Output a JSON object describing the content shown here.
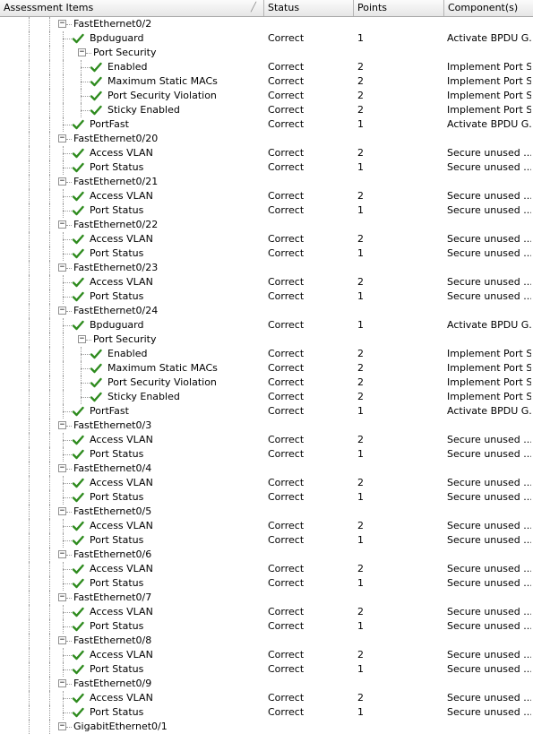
{
  "header": {
    "columns": [
      {
        "label": "Assessment Items"
      },
      {
        "label": "Status"
      },
      {
        "label": "Points"
      },
      {
        "label": "Component(s)"
      }
    ]
  },
  "colors": {
    "check": "#2e8b1e",
    "guide": "#9a9a9a",
    "header_bg": "#ececec"
  },
  "icons": {
    "expanded": "minus-box-icon",
    "check": "check-mark-icon"
  },
  "rows": [
    {
      "level": 0,
      "kind": "group",
      "label": "FastEthernet0/2"
    },
    {
      "level": 1,
      "kind": "item",
      "label": "Bpduguard",
      "status": "Correct",
      "points": "1",
      "component": "Activate BPDU G..."
    },
    {
      "level": 1,
      "kind": "group",
      "label": "Port Security"
    },
    {
      "level": 2,
      "kind": "item",
      "label": "Enabled",
      "status": "Correct",
      "points": "2",
      "component": "Implement Port S..."
    },
    {
      "level": 2,
      "kind": "item",
      "label": "Maximum Static MACs",
      "status": "Correct",
      "points": "2",
      "component": "Implement Port S..."
    },
    {
      "level": 2,
      "kind": "item",
      "label": "Port Security Violation",
      "status": "Correct",
      "points": "2",
      "component": "Implement Port S..."
    },
    {
      "level": 2,
      "kind": "item",
      "label": "Sticky Enabled",
      "status": "Correct",
      "points": "2",
      "component": "Implement Port S..."
    },
    {
      "level": 1,
      "kind": "item",
      "label": "PortFast",
      "status": "Correct",
      "points": "1",
      "component": "Activate BPDU G..."
    },
    {
      "level": 0,
      "kind": "group",
      "label": "FastEthernet0/20"
    },
    {
      "level": 1,
      "kind": "item",
      "label": "Access VLAN",
      "status": "Correct",
      "points": "2",
      "component": "Secure unused ..."
    },
    {
      "level": 1,
      "kind": "item",
      "label": "Port Status",
      "status": "Correct",
      "points": "1",
      "component": "Secure unused ..."
    },
    {
      "level": 0,
      "kind": "group",
      "label": "FastEthernet0/21"
    },
    {
      "level": 1,
      "kind": "item",
      "label": "Access VLAN",
      "status": "Correct",
      "points": "2",
      "component": "Secure unused ..."
    },
    {
      "level": 1,
      "kind": "item",
      "label": "Port Status",
      "status": "Correct",
      "points": "1",
      "component": "Secure unused ..."
    },
    {
      "level": 0,
      "kind": "group",
      "label": "FastEthernet0/22"
    },
    {
      "level": 1,
      "kind": "item",
      "label": "Access VLAN",
      "status": "Correct",
      "points": "2",
      "component": "Secure unused ..."
    },
    {
      "level": 1,
      "kind": "item",
      "label": "Port Status",
      "status": "Correct",
      "points": "1",
      "component": "Secure unused ..."
    },
    {
      "level": 0,
      "kind": "group",
      "label": "FastEthernet0/23"
    },
    {
      "level": 1,
      "kind": "item",
      "label": "Access VLAN",
      "status": "Correct",
      "points": "2",
      "component": "Secure unused ..."
    },
    {
      "level": 1,
      "kind": "item",
      "label": "Port Status",
      "status": "Correct",
      "points": "1",
      "component": "Secure unused ..."
    },
    {
      "level": 0,
      "kind": "group",
      "label": "FastEthernet0/24"
    },
    {
      "level": 1,
      "kind": "item",
      "label": "Bpduguard",
      "status": "Correct",
      "points": "1",
      "component": "Activate BPDU G..."
    },
    {
      "level": 1,
      "kind": "group",
      "label": "Port Security"
    },
    {
      "level": 2,
      "kind": "item",
      "label": "Enabled",
      "status": "Correct",
      "points": "2",
      "component": "Implement Port S..."
    },
    {
      "level": 2,
      "kind": "item",
      "label": "Maximum Static MACs",
      "status": "Correct",
      "points": "2",
      "component": "Implement Port S..."
    },
    {
      "level": 2,
      "kind": "item",
      "label": "Port Security Violation",
      "status": "Correct",
      "points": "2",
      "component": "Implement Port S..."
    },
    {
      "level": 2,
      "kind": "item",
      "label": "Sticky Enabled",
      "status": "Correct",
      "points": "2",
      "component": "Implement Port S..."
    },
    {
      "level": 1,
      "kind": "item",
      "label": "PortFast",
      "status": "Correct",
      "points": "1",
      "component": "Activate BPDU G..."
    },
    {
      "level": 0,
      "kind": "group",
      "label": "FastEthernet0/3"
    },
    {
      "level": 1,
      "kind": "item",
      "label": "Access VLAN",
      "status": "Correct",
      "points": "2",
      "component": "Secure unused ..."
    },
    {
      "level": 1,
      "kind": "item",
      "label": "Port Status",
      "status": "Correct",
      "points": "1",
      "component": "Secure unused ..."
    },
    {
      "level": 0,
      "kind": "group",
      "label": "FastEthernet0/4"
    },
    {
      "level": 1,
      "kind": "item",
      "label": "Access VLAN",
      "status": "Correct",
      "points": "2",
      "component": "Secure unused ..."
    },
    {
      "level": 1,
      "kind": "item",
      "label": "Port Status",
      "status": "Correct",
      "points": "1",
      "component": "Secure unused ..."
    },
    {
      "level": 0,
      "kind": "group",
      "label": "FastEthernet0/5"
    },
    {
      "level": 1,
      "kind": "item",
      "label": "Access VLAN",
      "status": "Correct",
      "points": "2",
      "component": "Secure unused ..."
    },
    {
      "level": 1,
      "kind": "item",
      "label": "Port Status",
      "status": "Correct",
      "points": "1",
      "component": "Secure unused ..."
    },
    {
      "level": 0,
      "kind": "group",
      "label": "FastEthernet0/6"
    },
    {
      "level": 1,
      "kind": "item",
      "label": "Access VLAN",
      "status": "Correct",
      "points": "2",
      "component": "Secure unused ..."
    },
    {
      "level": 1,
      "kind": "item",
      "label": "Port Status",
      "status": "Correct",
      "points": "1",
      "component": "Secure unused ..."
    },
    {
      "level": 0,
      "kind": "group",
      "label": "FastEthernet0/7"
    },
    {
      "level": 1,
      "kind": "item",
      "label": "Access VLAN",
      "status": "Correct",
      "points": "2",
      "component": "Secure unused ..."
    },
    {
      "level": 1,
      "kind": "item",
      "label": "Port Status",
      "status": "Correct",
      "points": "1",
      "component": "Secure unused ..."
    },
    {
      "level": 0,
      "kind": "group",
      "label": "FastEthernet0/8"
    },
    {
      "level": 1,
      "kind": "item",
      "label": "Access VLAN",
      "status": "Correct",
      "points": "2",
      "component": "Secure unused ..."
    },
    {
      "level": 1,
      "kind": "item",
      "label": "Port Status",
      "status": "Correct",
      "points": "1",
      "component": "Secure unused ..."
    },
    {
      "level": 0,
      "kind": "group",
      "label": "FastEthernet0/9"
    },
    {
      "level": 1,
      "kind": "item",
      "label": "Access VLAN",
      "status": "Correct",
      "points": "2",
      "component": "Secure unused ..."
    },
    {
      "level": 1,
      "kind": "item",
      "label": "Port Status",
      "status": "Correct",
      "points": "1",
      "component": "Secure unused ..."
    },
    {
      "level": 0,
      "kind": "group",
      "label": "GigabitEthernet0/1"
    }
  ]
}
